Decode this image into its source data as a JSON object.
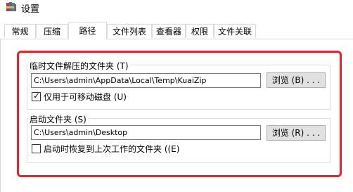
{
  "window": {
    "title": "设置",
    "icon": "winrar-books-icon"
  },
  "tabs": [
    {
      "label": "常规",
      "active": false
    },
    {
      "label": "压缩",
      "active": false
    },
    {
      "label": "路径",
      "active": true
    },
    {
      "label": "文件列表",
      "active": false
    },
    {
      "label": "查看器",
      "active": false
    },
    {
      "label": "权限",
      "active": false
    },
    {
      "label": "文件关联",
      "active": false
    }
  ],
  "temp_group": {
    "title": "临时文件解压的文件夹 (T)",
    "path_value": "C:\\Users\\admin\\AppData\\Local\\Temp\\KuaiZip",
    "browse_label": "浏览 (B) . . .",
    "removable_only_label": "仅用于可移动磁盘 (U)",
    "removable_only_checked": true
  },
  "start_group": {
    "title": "启动文件夹 (S)",
    "path_value": "C:\\Users\\admin\\Desktop",
    "browse_label": "浏览 (R) . . .",
    "restore_last_label": "启动时恢复到上次工作的文件夹 ((E)",
    "restore_last_checked": false
  },
  "colors": {
    "highlight": "#e8222c",
    "tab_border": "#d9d9d9",
    "button_bg": "#e1e1e1"
  }
}
